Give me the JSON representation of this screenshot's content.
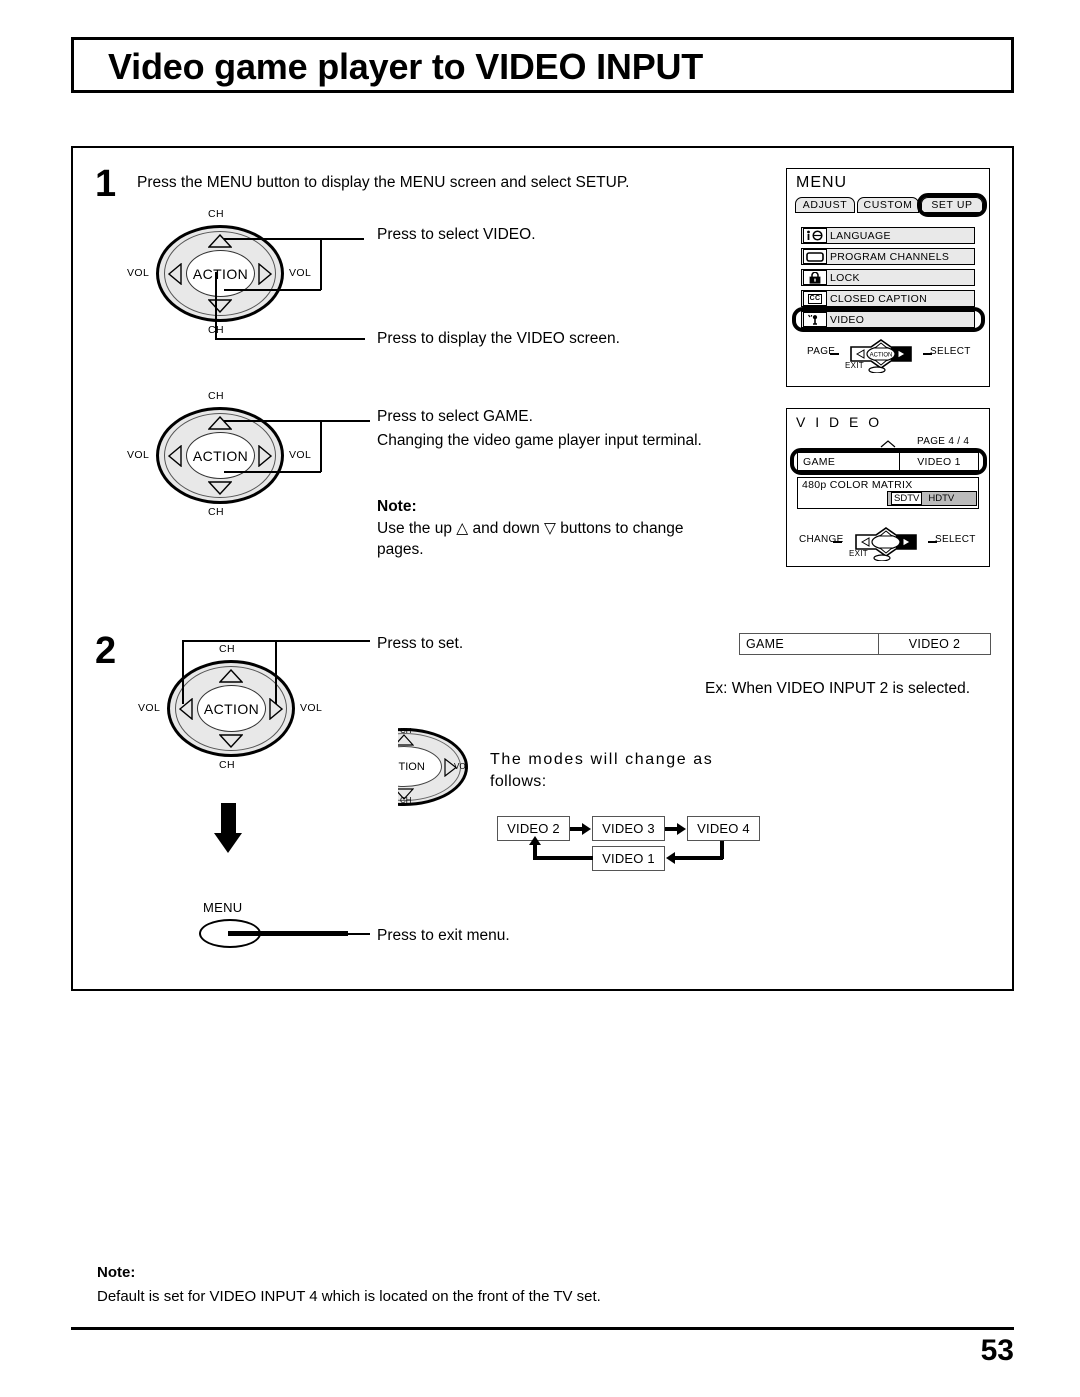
{
  "page": {
    "title": "Video game player to VIDEO INPUT",
    "number": "53"
  },
  "steps": [
    {
      "number": "1",
      "intro": "Press the MENU button to display the MENU screen and select SETUP.",
      "callouts": [
        "Press to select VIDEO.",
        "Press to display the VIDEO screen.",
        "Press to select  GAME.",
        "Changing the video game player input terminal."
      ],
      "note_label": "Note:",
      "note_line1": "Use the up △ and down ▽ buttons to change",
      "note_line2": "pages."
    },
    {
      "number": "2",
      "callouts": [
        "Press to set.",
        "Press to exit menu."
      ],
      "example_text": "Ex: When VIDEO INPUT 2 is selected.",
      "modes_line1": "The modes will change as",
      "modes_line2": "follows:"
    }
  ],
  "remote": {
    "center_label": "ACTION",
    "top_label": "CH",
    "bottom_label": "CH",
    "left_label": "VOL",
    "right_label": "VOL",
    "menu_button_label": "MENU"
  },
  "menu_panel": {
    "title": "MENU",
    "tabs": [
      {
        "label": "ADJUST",
        "selected": false
      },
      {
        "label": "CUSTOM",
        "selected": false
      },
      {
        "label": "SET  UP",
        "selected": true
      }
    ],
    "items": [
      {
        "icon": "language-icon",
        "glyph": "ı☺",
        "label": "LANGUAGE",
        "selected": false
      },
      {
        "icon": "tv-screen-icon",
        "glyph": "",
        "label": "PROGRAM  CHANNELS",
        "selected": false
      },
      {
        "icon": "padlock-icon",
        "glyph": "",
        "label": "LOCK",
        "selected": false
      },
      {
        "icon": "closed-caption-icon",
        "glyph": "CC",
        "label": "CLOSED  CAPTION",
        "selected": false
      },
      {
        "icon": "video-hand-icon",
        "glyph": "",
        "label": "VIDEO",
        "selected": true
      }
    ],
    "footer_left": "PAGE",
    "footer_right": "SELECT",
    "footer_exit": "EXIT",
    "pad_label": "ACTION"
  },
  "video_panel": {
    "title": "V I D E O",
    "page_indicator": "PAGE 4 / 4",
    "rows": [
      {
        "label": "GAME",
        "value": "VIDEO 1",
        "selected": true
      },
      {
        "label": "480p  COLOR MATRIX",
        "value": "SDTV ̸ ̸ HDTV",
        "selected": false
      }
    ],
    "value_left": "SDTV",
    "value_right": "HDTV",
    "footer_left": "CHANGE",
    "footer_right": "SELECT",
    "footer_exit": "EXIT"
  },
  "game_result": {
    "label": "GAME",
    "value": "VIDEO 2"
  },
  "mode_flow": {
    "boxes": [
      "VIDEO 2",
      "VIDEO 3",
      "VIDEO 4",
      "VIDEO 1"
    ]
  },
  "bottom_note": {
    "label": "Note:",
    "text": "Default is set for VIDEO INPUT 4 which is located on the front of the TV set."
  }
}
